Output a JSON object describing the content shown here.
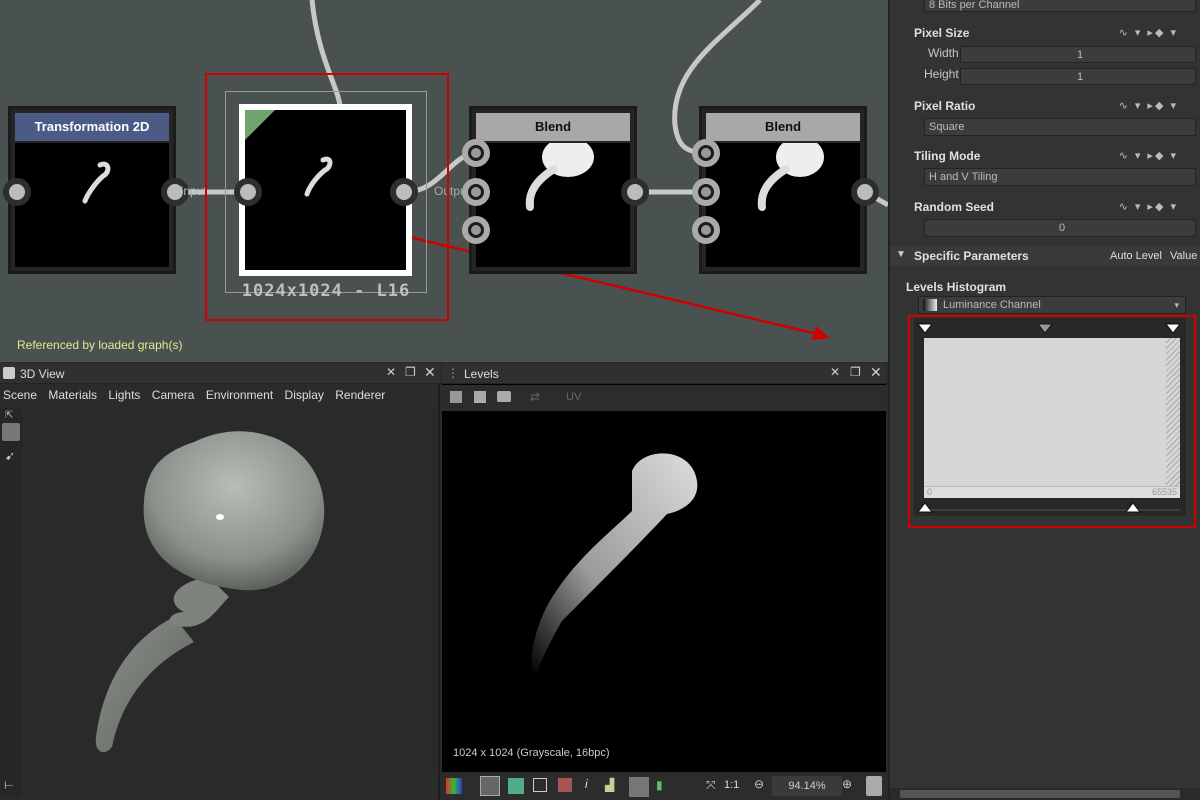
{
  "graph": {
    "status": "Referenced by loaded graph(s)",
    "node_transform_title": "Transformation 2D",
    "node_levels_resolution": "1024x1024 - L16",
    "node_blend1_title": "Blend",
    "node_blend2_title": "Blend",
    "pin_label_input": "Input",
    "pin_label_output": "Output"
  },
  "view3d": {
    "title": "3D View",
    "menu": [
      "Scene",
      "Materials",
      "Lights",
      "Camera",
      "Environment",
      "Display",
      "Renderer"
    ]
  },
  "view2d": {
    "title": "Levels",
    "uv_label": "UV",
    "info": "1024 x 1024 (Grayscale, 16bpc)",
    "ratio": "1:1",
    "zoom": "94.14%"
  },
  "params": {
    "format_value": "8 Bits per Channel",
    "pixel_size": {
      "label": "Pixel Size",
      "width_label": "Width",
      "width_value": "1",
      "height_label": "Height",
      "height_value": "1"
    },
    "pixel_ratio": {
      "label": "Pixel Ratio",
      "value": "Square"
    },
    "tiling_mode": {
      "label": "Tiling Mode",
      "value": "H and V Tiling"
    },
    "random_seed": {
      "label": "Random Seed",
      "value": "0"
    },
    "specific": {
      "title": "Specific Parameters",
      "auto_level": "Auto Level",
      "value_label": "Value"
    },
    "histogram": {
      "label": "Levels Histogram",
      "channel": "Luminance Channel",
      "min": "0",
      "max": "65535"
    }
  },
  "colors": {
    "graph_bg": "#4a5151",
    "annotation_red": "#d00000",
    "node_header_transform": "#4b5b85",
    "node_header_blend": "#a8a8a8",
    "status_text": "#e8e890"
  }
}
